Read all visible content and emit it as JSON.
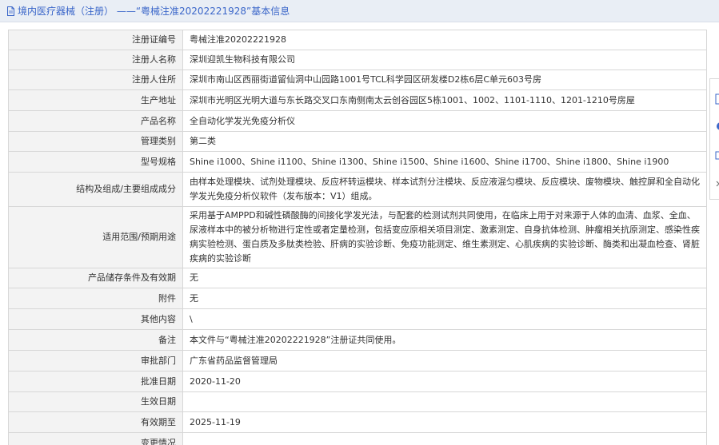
{
  "header": {
    "title": "境内医疗器械（注册） ——“粤械注准20202221928”基本信息"
  },
  "rows": [
    {
      "label": "注册证编号",
      "value": "粤械注准20202221928"
    },
    {
      "label": "注册人名称",
      "value": "深圳迎凯生物科技有限公司"
    },
    {
      "label": "注册人住所",
      "value": "深圳市南山区西丽街道留仙洞中山园路1001号TCL科学园区研发楼D2栋6层C单元603号房"
    },
    {
      "label": "生产地址",
      "value": "深圳市光明区光明大道与东长路交叉口东南侧南太云创谷园区5栋1001、1002、1101-1110、1201-1210号房屋"
    },
    {
      "label": "产品名称",
      "value": "全自动化学发光免疫分析仪"
    },
    {
      "label": "管理类别",
      "value": "第二类"
    },
    {
      "label": "型号规格",
      "value": "Shine i1000、Shine i1100、Shine i1300、Shine i1500、Shine i1600、Shine i1700、Shine i1800、Shine i1900"
    },
    {
      "label": "结构及组成/主要组成成分",
      "value": "由样本处理模块、试剂处理模块、反应杯转运模块、样本试剂分注模块、反应液混匀模块、反应模块、废物模块、触控屏和全自动化学发光免疫分析仪软件（发布版本：V1）组成。"
    },
    {
      "label": "适用范围/预期用途",
      "value": "采用基于AMPPD和碱性磷酸酶的间接化学发光法，与配套的检测试剂共同使用，在临床上用于对来源于人体的血清、血浆、全血、尿液样本中的被分析物进行定性或者定量检测，包括变应原相关项目测定、激素测定、自身抗体检测、肿瘤相关抗原测定、感染性疾病实验检测、蛋白质及多肽类检验、肝病的实验诊断、免疫功能测定、维生素测定、心肌疾病的实验诊断、酶类和出凝血检查、肾脏疾病的实验诊断"
    },
    {
      "label": "产品储存条件及有效期",
      "value": "无"
    },
    {
      "label": "附件",
      "value": "无"
    },
    {
      "label": "其他内容",
      "value": "\\"
    },
    {
      "label": "备注",
      "value": "本文件与“粤械注准20202221928”注册证共同使用。"
    },
    {
      "label": "审批部门",
      "value": "广东省药品监督管理局"
    },
    {
      "label": "批准日期",
      "value": "2020-11-20"
    },
    {
      "label": "生效日期",
      "value": ""
    },
    {
      "label": "有效期至",
      "value": "2025-11-19"
    },
    {
      "label": "变更情况",
      "value": ""
    }
  ]
}
